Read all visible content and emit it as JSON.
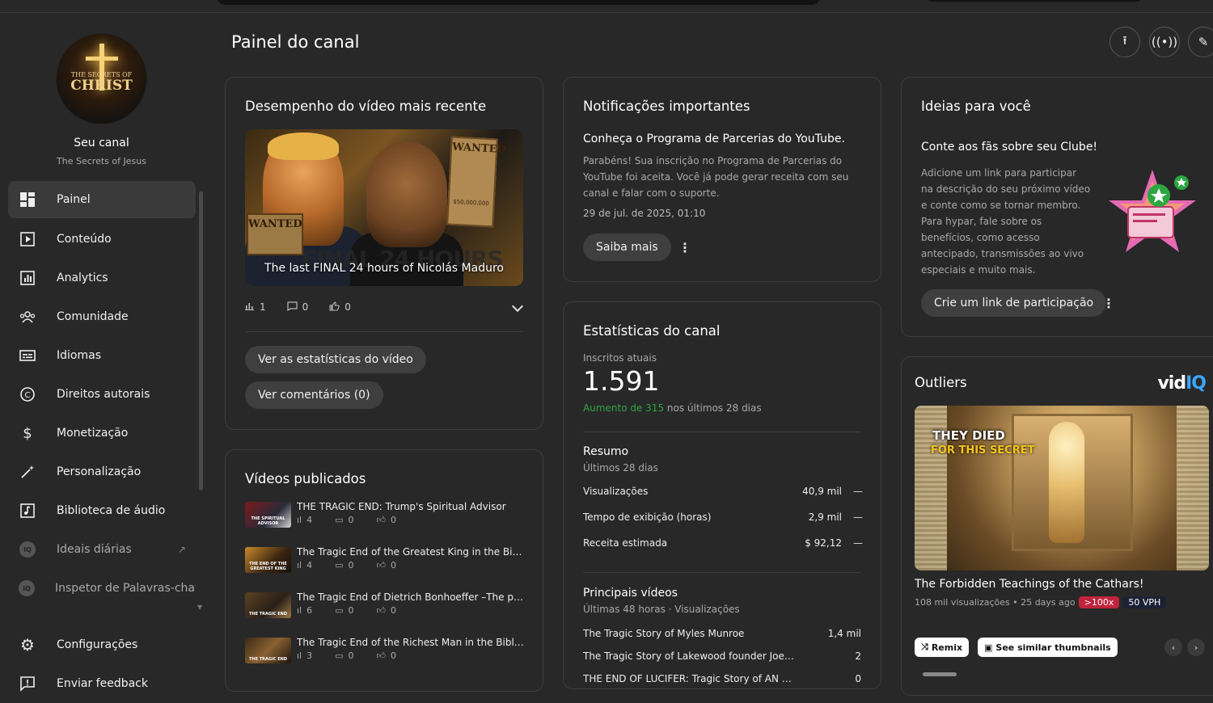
{
  "page": {
    "title": "Painel do canal"
  },
  "channel": {
    "name": "Seu canal",
    "subtitle": "The Secrets of Jesus",
    "avatar_line1": "THE SECRETS OF",
    "avatar_line2": "CHRIST"
  },
  "nav": {
    "items": [
      {
        "label": "Painel",
        "icon": "dashboard-icon"
      },
      {
        "label": "Conteúdo",
        "icon": "content-icon"
      },
      {
        "label": "Analytics",
        "icon": "analytics-icon"
      },
      {
        "label": "Comunidade",
        "icon": "community-icon"
      },
      {
        "label": "Idiomas",
        "icon": "subtitles-icon"
      },
      {
        "label": "Direitos autorais",
        "icon": "copyright-icon"
      },
      {
        "label": "Monetização",
        "icon": "dollar-icon"
      },
      {
        "label": "Personalização",
        "icon": "magic-wand-icon"
      },
      {
        "label": "Biblioteca de áudio",
        "icon": "audio-library-icon"
      },
      {
        "label": "Ideais diárias",
        "icon": "vidiq-icon"
      },
      {
        "label": "Inspetor de Palavras-chave",
        "icon": "vidiq-icon"
      }
    ],
    "bottom": [
      {
        "label": "Configurações",
        "icon": "gear-icon"
      },
      {
        "label": "Enviar feedback",
        "icon": "feedback-icon"
      }
    ]
  },
  "latest": {
    "heading": "Desempenho do vídeo mais recente",
    "thumb_caption": "The last FINAL 24 hours of Nicolás Maduro",
    "thumb_bigtext": "FINAL 24 HOURS",
    "thumb_wanted": "WANTED",
    "thumb_reward": "$50,000,000",
    "views": "1",
    "comments": "0",
    "likes": "0",
    "btn_stats": "Ver as estatísticas do vídeo",
    "btn_comments": "Ver comentários (0)"
  },
  "published": {
    "heading": "Vídeos publicados",
    "videos": [
      {
        "title": "THE TRAGIC END: Trump's Spiritual Advisor",
        "views": "4",
        "comments": "0",
        "likes": "0",
        "thumb_label": "THE SPIRITUAL ADVISOR"
      },
      {
        "title": "The Tragic End of the Greatest King in the Bible ...",
        "views": "4",
        "comments": "0",
        "likes": "0",
        "thumb_label": "THE END OF THE GREATEST KING"
      },
      {
        "title": "The Tragic End of Dietrich Bonhoeffer –The pa...",
        "views": "6",
        "comments": "0",
        "likes": "0",
        "thumb_label": "THE TRAGIC END"
      },
      {
        "title": "The Tragic End of the Richest Man in the Bible K...",
        "views": "3",
        "comments": "0",
        "likes": "0",
        "thumb_label": "THE TRAGIC END"
      }
    ]
  },
  "notifications": {
    "heading": "Notificações importantes",
    "title": "Conheça o Programa de Parcerias do YouTube.",
    "body": "Parabéns! Sua inscrição no Programa de Parcerias do YouTube foi aceita. Você já pode gerar receita com seu canal e falar com o suporte.",
    "date": "29 de jul. de 2025, 01:10",
    "button": "Saiba mais"
  },
  "stats": {
    "heading": "Estatísticas do canal",
    "subs_label": "Inscritos atuais",
    "subs_value": "1.591",
    "growth_highlight": "Aumento de 315",
    "growth_rest": " nos últimos 28 dias",
    "summary_title": "Resumo",
    "summary_period": "Últimos 28 dias",
    "rows": [
      {
        "label": "Visualizações",
        "value": "40,9 mil",
        "trend": "—"
      },
      {
        "label": "Tempo de exibição (horas)",
        "value": "2,9 mil",
        "trend": "—"
      },
      {
        "label": "Receita estimada",
        "value": "$ 92,12",
        "trend": "—"
      }
    ],
    "top_title": "Principais vídeos",
    "top_period": "Últimas 48 horas · Visualizações",
    "top": [
      {
        "title": "The Tragic Story of Myles Munroe",
        "value": "1,4 mil"
      },
      {
        "title": "The Tragic Story of Lakewood founder Joel Osteen'...",
        "value": "2"
      },
      {
        "title": "THE END OF LUCIFER: Tragic Story of AN Angel Wh...",
        "value": "0"
      }
    ]
  },
  "ideas": {
    "heading": "Ideias para você",
    "title": "Conte aos fãs sobre seu Clube!",
    "body": "Adicione um link para participar na descrição do seu próximo vídeo e conte como se tornar membro. Para hypar, fale sobre os benefícios, como acesso antecipado, transmissões ao vivo especiais e muito mais.",
    "button": "Crie um link de participação"
  },
  "outliers": {
    "heading": "Outliers",
    "brand_main": "vid",
    "brand_accent": "IQ",
    "thumb_line1": "THEY DIED",
    "thumb_line2": "FOR THIS SECRET",
    "video_title": "The Forbidden Teachings of the Cathars!",
    "meta": "108 mil visualizações • 25 days ago",
    "badge_multiplier": ">100x",
    "badge_vph": "50 VPH",
    "btn_remix": "Remix",
    "btn_similar": "See similar thumbnails"
  },
  "colors": {
    "accent_green": "#2ba640",
    "badge_red": "#c0243c",
    "badge_dark": "#1b2236",
    "vidiq_blue": "#3aa6ff"
  }
}
